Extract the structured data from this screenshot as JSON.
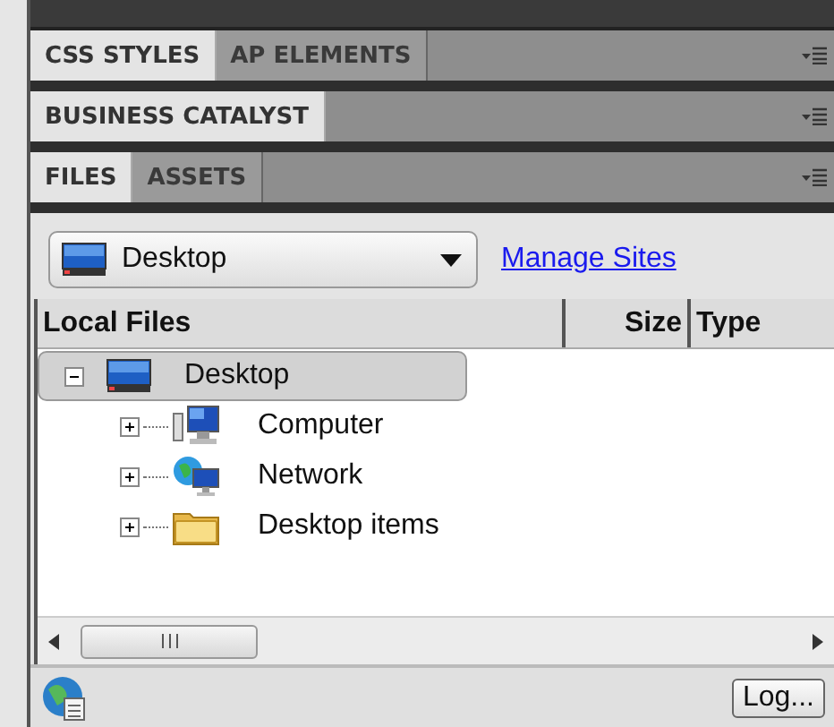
{
  "panel_groups": [
    {
      "tabs": [
        {
          "label": "CSS STYLES",
          "selected": true
        },
        {
          "label": "AP ELEMENTS",
          "selected": false
        }
      ]
    },
    {
      "tabs": [
        {
          "label": "BUSINESS CATALYST",
          "selected": true
        }
      ]
    },
    {
      "tabs": [
        {
          "label": "FILES",
          "selected": true
        },
        {
          "label": "ASSETS",
          "selected": false
        }
      ]
    }
  ],
  "files": {
    "site_select": {
      "value": "Desktop"
    },
    "manage_link": "Manage Sites",
    "columns": [
      "Local Files",
      "Size",
      "Type"
    ],
    "tree": [
      {
        "label": "Desktop",
        "kind": "desktop",
        "expanded": true,
        "selected": true,
        "children": [
          {
            "label": "Computer",
            "kind": "computer",
            "expanded": false,
            "selected": false
          },
          {
            "label": "Network",
            "kind": "network",
            "expanded": false,
            "selected": false
          },
          {
            "label": "Desktop items",
            "kind": "folder",
            "expanded": false,
            "selected": false
          }
        ]
      }
    ],
    "status_bar": {
      "log_button": "Log..."
    }
  }
}
